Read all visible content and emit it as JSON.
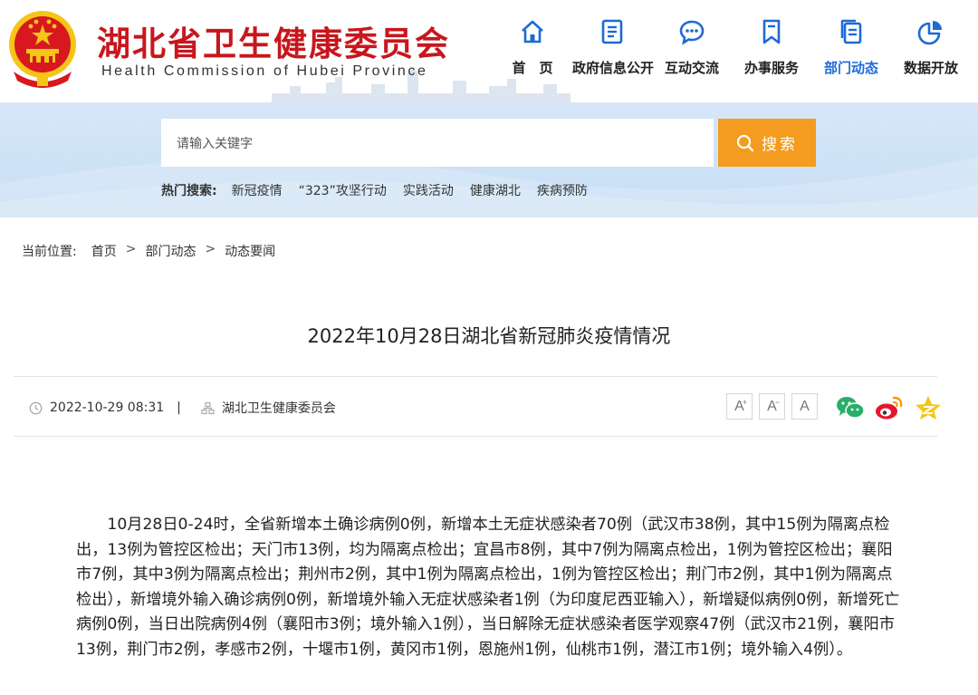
{
  "header": {
    "title": "湖北省卫生健康委员会",
    "subtitle": "Health Commission of Hubei Province"
  },
  "nav": {
    "items": [
      {
        "label": "首　页",
        "icon": "home-icon"
      },
      {
        "label": "政府信息公开",
        "icon": "document-icon"
      },
      {
        "label": "互动交流",
        "icon": "chat-icon"
      },
      {
        "label": "办事服务",
        "icon": "bookmark-icon"
      },
      {
        "label": "部门动态",
        "icon": "copy-icon",
        "active": true
      },
      {
        "label": "数据开放",
        "icon": "pie-chart-icon"
      }
    ]
  },
  "search": {
    "placeholder": "请输入关键字",
    "button_label": "搜索",
    "hot_label": "热门搜索:",
    "hot_links": [
      "新冠疫情",
      "“323”攻坚行动",
      "实践活动",
      "健康湖北",
      "疾病预防"
    ]
  },
  "breadcrumb": {
    "prefix": "当前位置:",
    "items": [
      "首页",
      "部门动态",
      "动态要闻"
    ],
    "separator": ">"
  },
  "article": {
    "title": "2022年10月28日湖北省新冠肺炎疫情情况",
    "date": "2022-10-29 08:31",
    "divider": "|",
    "source": "湖北卫生健康委员会",
    "font_sizes": [
      "A",
      "A",
      "A"
    ],
    "body": "10月28日0-24时，全省新增本土确诊病例0例，新增本土无症状感染者70例（武汉市38例，其中15例为隔离点检出，13例为管控区检出；天门市13例，均为隔离点检出；宜昌市8例，其中7例为隔离点检出，1例为管控区检出；襄阳市7例，其中3例为隔离点检出；荆州市2例，其中1例为隔离点检出，1例为管控区检出；荆门市2例，其中1例为隔离点检出），新增境外输入确诊病例0例，新增境外输入无症状感染者1例（为印度尼西亚输入），新增疑似病例0例，新增死亡病例0例，当日出院病例4例（襄阳市3例；境外输入1例），当日解除无症状感染者医学观察47例（武汉市21例，襄阳市13例，荆门市2例，孝感市2例，十堰市1例，黄冈市1例，恩施州1例，仙桃市1例，潜江市1例；境外输入4例）。"
  },
  "colors": {
    "brand_red": "#c8161d",
    "accent_blue": "#1d6ad6",
    "search_orange": "#f39c1f",
    "band_blue": "#d6e7f8"
  }
}
